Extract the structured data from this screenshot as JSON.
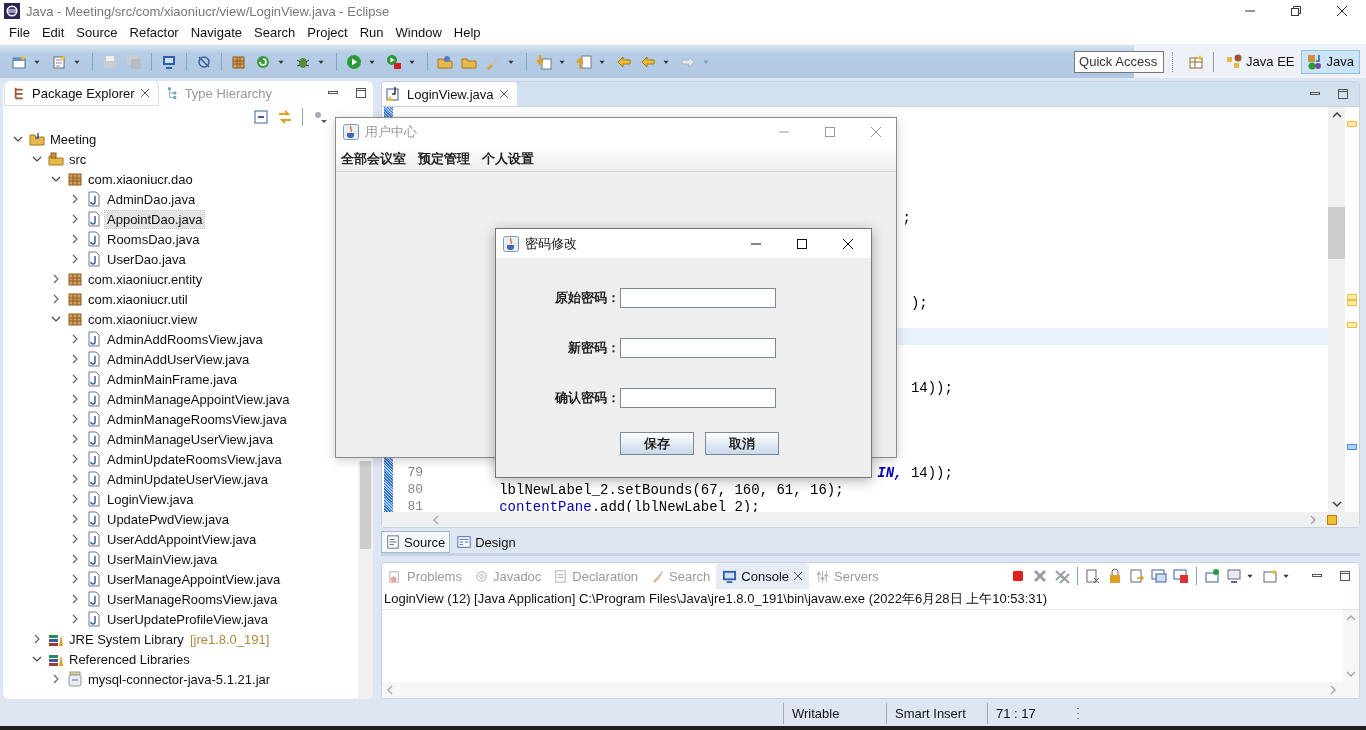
{
  "window": {
    "title": "Java - Meeting/src/com/xiaoniucr/view/LoginView.java - Eclipse"
  },
  "menu": [
    "File",
    "Edit",
    "Source",
    "Refactor",
    "Navigate",
    "Search",
    "Project",
    "Run",
    "Window",
    "Help"
  ],
  "toolbar": {
    "quick_access": {
      "placeholder": "Quick Access"
    },
    "perspectives": [
      {
        "label": "Java EE",
        "selected": false
      },
      {
        "label": "Java",
        "selected": true
      }
    ]
  },
  "explorer": {
    "tabs": [
      {
        "label": "Package Explorer",
        "selected": true
      },
      {
        "label": "Type Hierarchy",
        "selected": false
      }
    ],
    "tree": [
      {
        "label": "Meeting",
        "kind": "project",
        "expanded": true,
        "selected": false,
        "children": [
          {
            "label": "src",
            "kind": "src",
            "expanded": true,
            "selected": false,
            "children": [
              {
                "label": "com.xiaoniucr.dao",
                "kind": "package",
                "expanded": true,
                "selected": false,
                "children": [
                  {
                    "label": "AdminDao.java",
                    "kind": "java",
                    "expanded": false,
                    "selected": false
                  },
                  {
                    "label": "AppointDao.java",
                    "kind": "java",
                    "expanded": false,
                    "selected": true
                  },
                  {
                    "label": "RoomsDao.java",
                    "kind": "java",
                    "expanded": false,
                    "selected": false
                  },
                  {
                    "label": "UserDao.java",
                    "kind": "java",
                    "expanded": false,
                    "selected": false
                  }
                ]
              },
              {
                "label": "com.xiaoniucr.entity",
                "kind": "package",
                "expanded": false,
                "selected": false
              },
              {
                "label": "com.xiaoniucr.util",
                "kind": "package",
                "expanded": false,
                "selected": false
              },
              {
                "label": "com.xiaoniucr.view",
                "kind": "package",
                "expanded": true,
                "selected": false,
                "children": [
                  {
                    "label": "AdminAddRoomsView.java",
                    "kind": "java",
                    "expanded": false,
                    "selected": false
                  },
                  {
                    "label": "AdminAddUserView.java",
                    "kind": "java",
                    "expanded": false,
                    "selected": false
                  },
                  {
                    "label": "AdminMainFrame.java",
                    "kind": "java",
                    "expanded": false,
                    "selected": false
                  },
                  {
                    "label": "AdminManageAppointView.java",
                    "kind": "java",
                    "expanded": false,
                    "selected": false
                  },
                  {
                    "label": "AdminManageRoomsView.java",
                    "kind": "java",
                    "expanded": false,
                    "selected": false
                  },
                  {
                    "label": "AdminManageUserView.java",
                    "kind": "java",
                    "expanded": false,
                    "selected": false
                  },
                  {
                    "label": "AdminUpdateRoomsView.java",
                    "kind": "java",
                    "expanded": false,
                    "selected": false
                  },
                  {
                    "label": "AdminUpdateUserView.java",
                    "kind": "java",
                    "expanded": false,
                    "selected": false
                  },
                  {
                    "label": "LoginView.java",
                    "kind": "java",
                    "expanded": false,
                    "selected": false
                  },
                  {
                    "label": "UpdatePwdView.java",
                    "kind": "java",
                    "expanded": false,
                    "selected": false
                  },
                  {
                    "label": "UserAddAppointView.java",
                    "kind": "java",
                    "expanded": false,
                    "selected": false
                  },
                  {
                    "label": "UserMainView.java",
                    "kind": "java",
                    "expanded": false,
                    "selected": false
                  },
                  {
                    "label": "UserManageAppointView.java",
                    "kind": "java",
                    "expanded": false,
                    "selected": false
                  },
                  {
                    "label": "UserManageRoomsView.java",
                    "kind": "java",
                    "expanded": false,
                    "selected": false
                  },
                  {
                    "label": "UserUpdateProfileView.java",
                    "kind": "java",
                    "expanded": false,
                    "selected": false
                  }
                ]
              }
            ]
          },
          {
            "label": "JRE System Library",
            "decoration": "[jre1.8.0_191]",
            "kind": "library",
            "expanded": false,
            "selected": false
          },
          {
            "label": "Referenced Libraries",
            "kind": "library",
            "expanded": true,
            "selected": false,
            "children": [
              {
                "label": "mysql-connector-java-5.1.21.jar",
                "kind": "jar",
                "expanded": false,
                "selected": false
              }
            ]
          }
        ]
      }
    ]
  },
  "editor": {
    "tabs": [
      {
        "label": "LoginView.java",
        "selected": true
      }
    ],
    "lines": [
      {
        "current": false
      },
      {
        "current": false
      },
      {
        "current": false
      },
      {
        "current": false
      },
      {
        "current": false
      },
      {
        "current": false
      },
      {
        "current": false,
        "segments": [
          {
            "text": "                                                        ;",
            "kind": "plain"
          }
        ]
      },
      {
        "current": false
      },
      {
        "current": false
      },
      {
        "current": false
      },
      {
        "current": false
      },
      {
        "current": false,
        "segments": [
          {
            "text": "                                                         );",
            "kind": "plain"
          }
        ]
      },
      {
        "current": false
      },
      {
        "current": true
      },
      {
        "current": false
      },
      {
        "current": false
      },
      {
        "current": false,
        "segments": [
          {
            "text": "                                                         14));",
            "kind": "plain"
          }
        ]
      },
      {
        "current": false
      },
      {
        "current": false
      },
      {
        "current": false
      },
      {
        "current": false
      },
      {
        "current": false,
        "number": "79",
        "segments": [
          {
            "text": "                                                     IN,",
            "kind": "constant"
          },
          {
            "text": " 14));",
            "kind": "plain"
          }
        ]
      },
      {
        "current": false,
        "number": "80",
        "segments": [
          {
            "text": "        lblNewLabel_2.setBounds(67, 160, 61, 16);",
            "kind": "plain"
          }
        ]
      },
      {
        "current": false,
        "number": "81",
        "segments": [
          {
            "text": "        contentPane",
            "kind": "field"
          },
          {
            "text": ".add(lblNewLabel_2);",
            "kind": "plain"
          }
        ]
      }
    ],
    "mode_tabs": [
      {
        "label": "Source",
        "selected": true
      },
      {
        "label": "Design",
        "selected": false
      }
    ]
  },
  "bottom_panel": {
    "tabs": [
      {
        "label": "Problems",
        "selected": false
      },
      {
        "label": "Javadoc",
        "selected": false
      },
      {
        "label": "Declaration",
        "selected": false
      },
      {
        "label": "Search",
        "selected": false
      },
      {
        "label": "Console",
        "selected": true
      },
      {
        "label": "Servers",
        "selected": false
      }
    ],
    "console_header": "LoginView (12) [Java Application] C:\\Program Files\\Java\\jre1.8.0_191\\bin\\javaw.exe (2022年6月28日 上午10:53:31)"
  },
  "status_bar": [
    "Writable",
    "Smart Insert",
    "71 : 17"
  ],
  "frame": {
    "title": "用户中心",
    "menu": [
      "全部会议室",
      "预定管理",
      "个人设置"
    ]
  },
  "dialog": {
    "title": "密码修改",
    "fields": [
      {
        "label": "原始密码："
      },
      {
        "label": "新密码："
      },
      {
        "label": "确认密码："
      }
    ],
    "buttons": [
      "保存",
      "取消"
    ]
  }
}
